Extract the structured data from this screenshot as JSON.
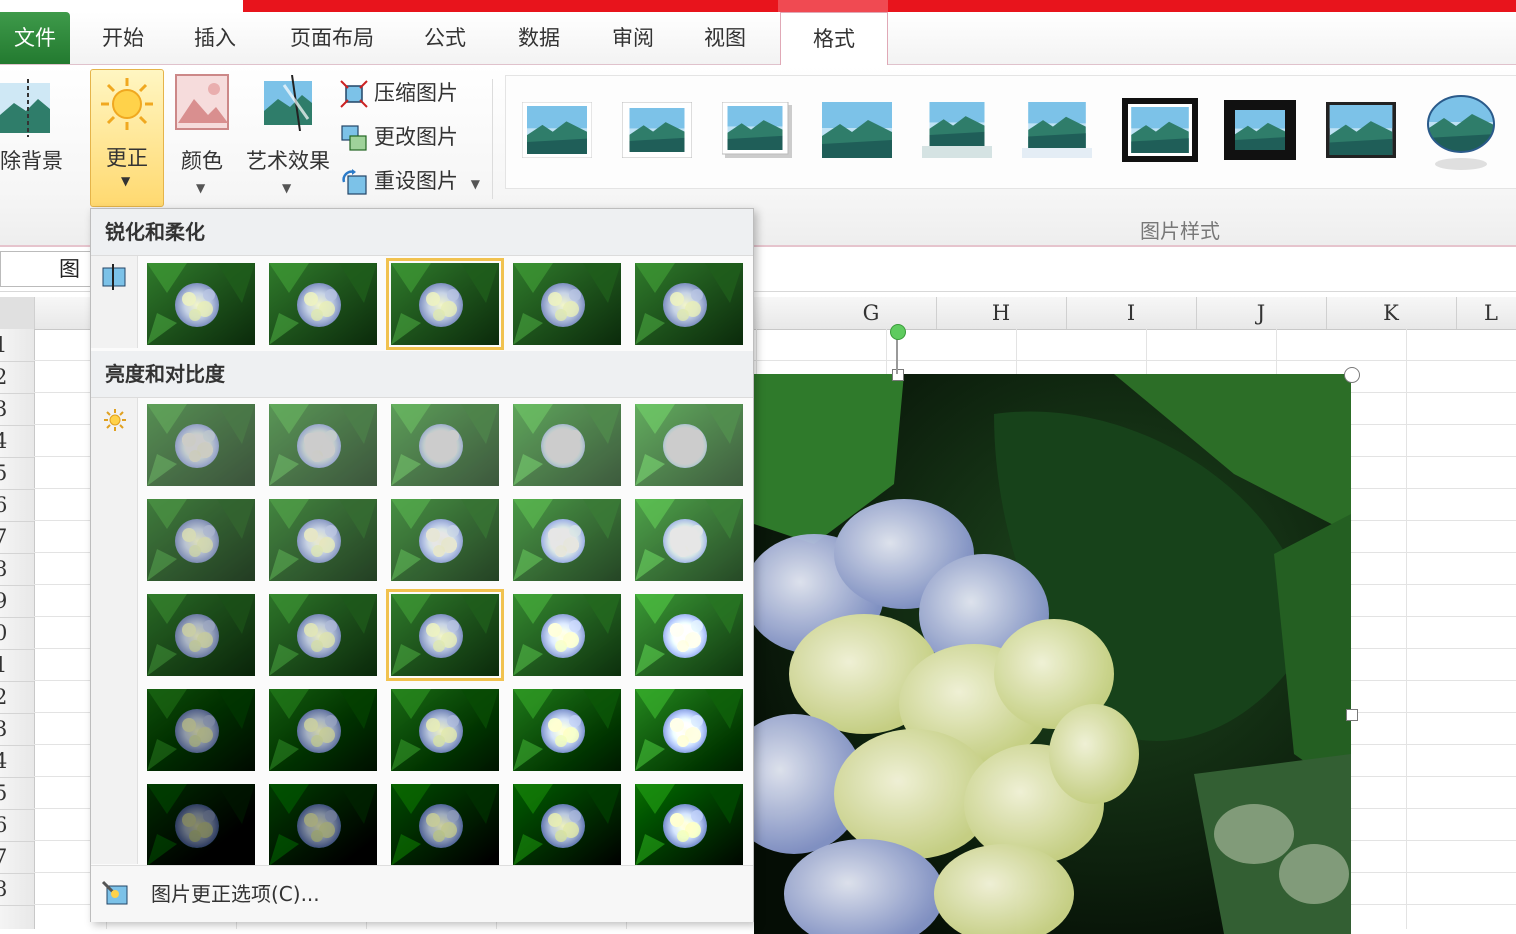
{
  "ribbon_tabs": {
    "file": "文件",
    "home": "开始",
    "insert": "插入",
    "page_layout": "页面布局",
    "formulas": "公式",
    "data": "数据",
    "review": "审阅",
    "view": "视图",
    "format": "格式"
  },
  "adjust": {
    "remove_background": "除背景",
    "corrections": "更正",
    "color": "颜色",
    "artistic_effects": "艺术效果",
    "compress_pictures": "压缩图片",
    "change_picture": "更改图片",
    "reset_picture": "重设图片"
  },
  "picture_styles": {
    "group_label": "图片样式",
    "count": 10
  },
  "name_box": {
    "value": "图"
  },
  "columns": [
    "G",
    "H",
    "I",
    "J",
    "K",
    "L"
  ],
  "rows": [
    "1",
    "2",
    "3",
    "4",
    "5",
    "6",
    "7",
    "8",
    "9",
    "0",
    "1",
    "2",
    "3",
    "4",
    "5",
    "6",
    "7",
    "8"
  ],
  "corrections_gallery": {
    "sharpen_title": "锐化和柔化",
    "brightness_title": "亮度和对比度",
    "sharpen_selected_index": 2,
    "brightness_selected_row": 2,
    "brightness_selected_col": 2,
    "options_label": "图片更正选项(C)..."
  },
  "colors": {
    "file_tab": "#2f8b3c",
    "title_bar": "#e8141c",
    "selection_highlight": "#f1c24f"
  }
}
